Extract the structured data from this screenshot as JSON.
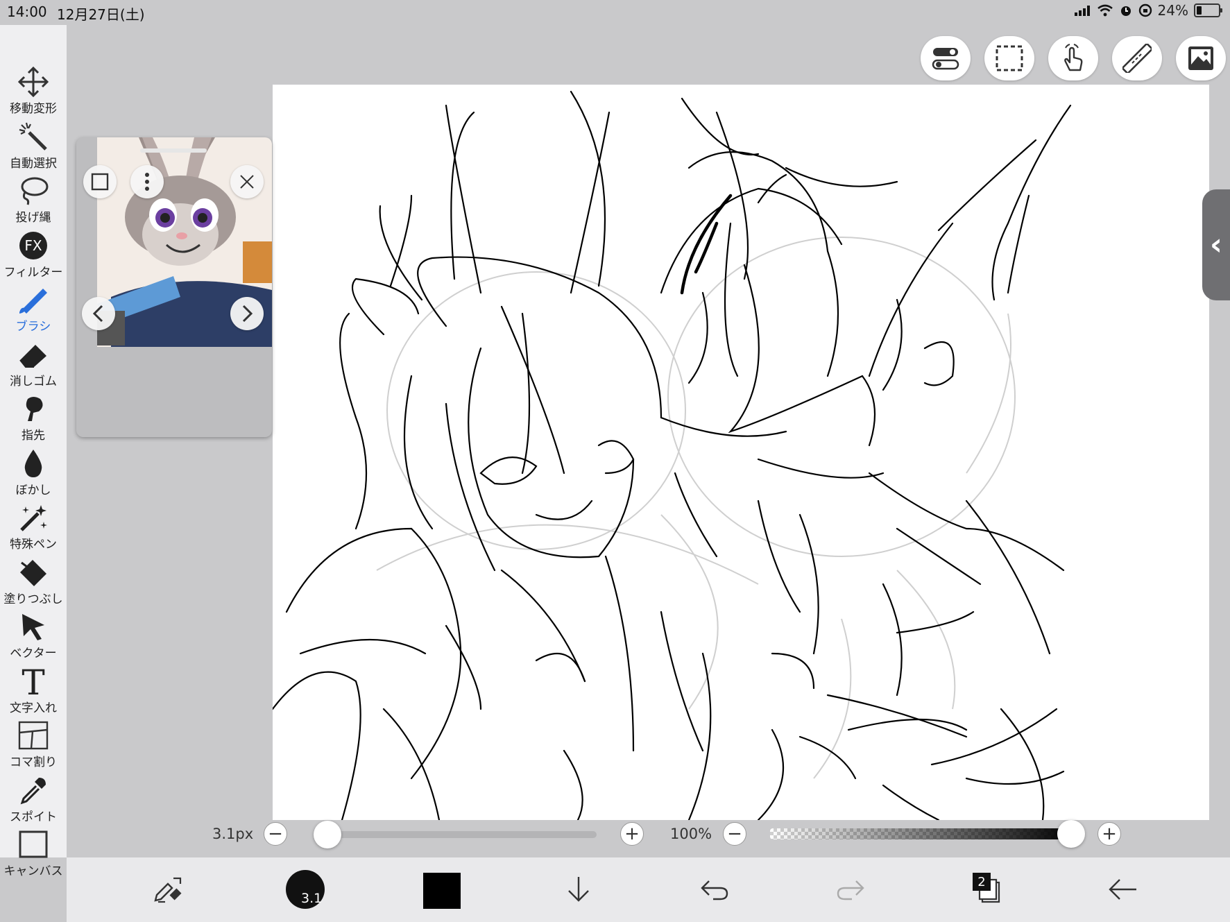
{
  "status": {
    "time": "14:00",
    "date": "12月27日(土)",
    "battery": "24%",
    "battery_level": 0.24
  },
  "tools": [
    {
      "label": "移動変形",
      "icon": "move-icon"
    },
    {
      "label": "自動選択",
      "icon": "magic-wand-icon"
    },
    {
      "label": "投げ縄",
      "icon": "lasso-icon"
    },
    {
      "label": "フィルター",
      "icon": "fx-filter-icon",
      "glyph": "FX"
    },
    {
      "label": "ブラシ",
      "icon": "brush-icon",
      "active": true
    },
    {
      "label": "消しゴム",
      "icon": "eraser-icon"
    },
    {
      "label": "指先",
      "icon": "finger-smudge-icon"
    },
    {
      "label": "ぼかし",
      "icon": "blur-drop-icon"
    },
    {
      "label": "特殊ペン",
      "icon": "special-pen-icon"
    },
    {
      "label": "塗りつぶし",
      "icon": "fill-bucket-icon"
    },
    {
      "label": "ベクター",
      "icon": "vector-cursor-icon"
    },
    {
      "label": "文字入れ",
      "icon": "text-icon",
      "glyph": "T"
    },
    {
      "label": "コマ割り",
      "icon": "panel-frame-icon"
    },
    {
      "label": "スポイト",
      "icon": "eyedropper-icon"
    },
    {
      "label": "キャンバス",
      "icon": "canvas-icon"
    }
  ],
  "top_buttons": [
    "toggle-settings-icon",
    "selection-rect-icon",
    "touch-gesture-icon",
    "ruler-icon",
    "image-material-icon"
  ],
  "brush": {
    "size_label": "3.1px",
    "size_level": 0.0,
    "preview_label": "3.1",
    "opacity_label": "100%",
    "opacity_level": 1.0
  },
  "color": {
    "current": "#000000",
    "accent": "#2a6fdb"
  },
  "layers": {
    "count": "2"
  }
}
